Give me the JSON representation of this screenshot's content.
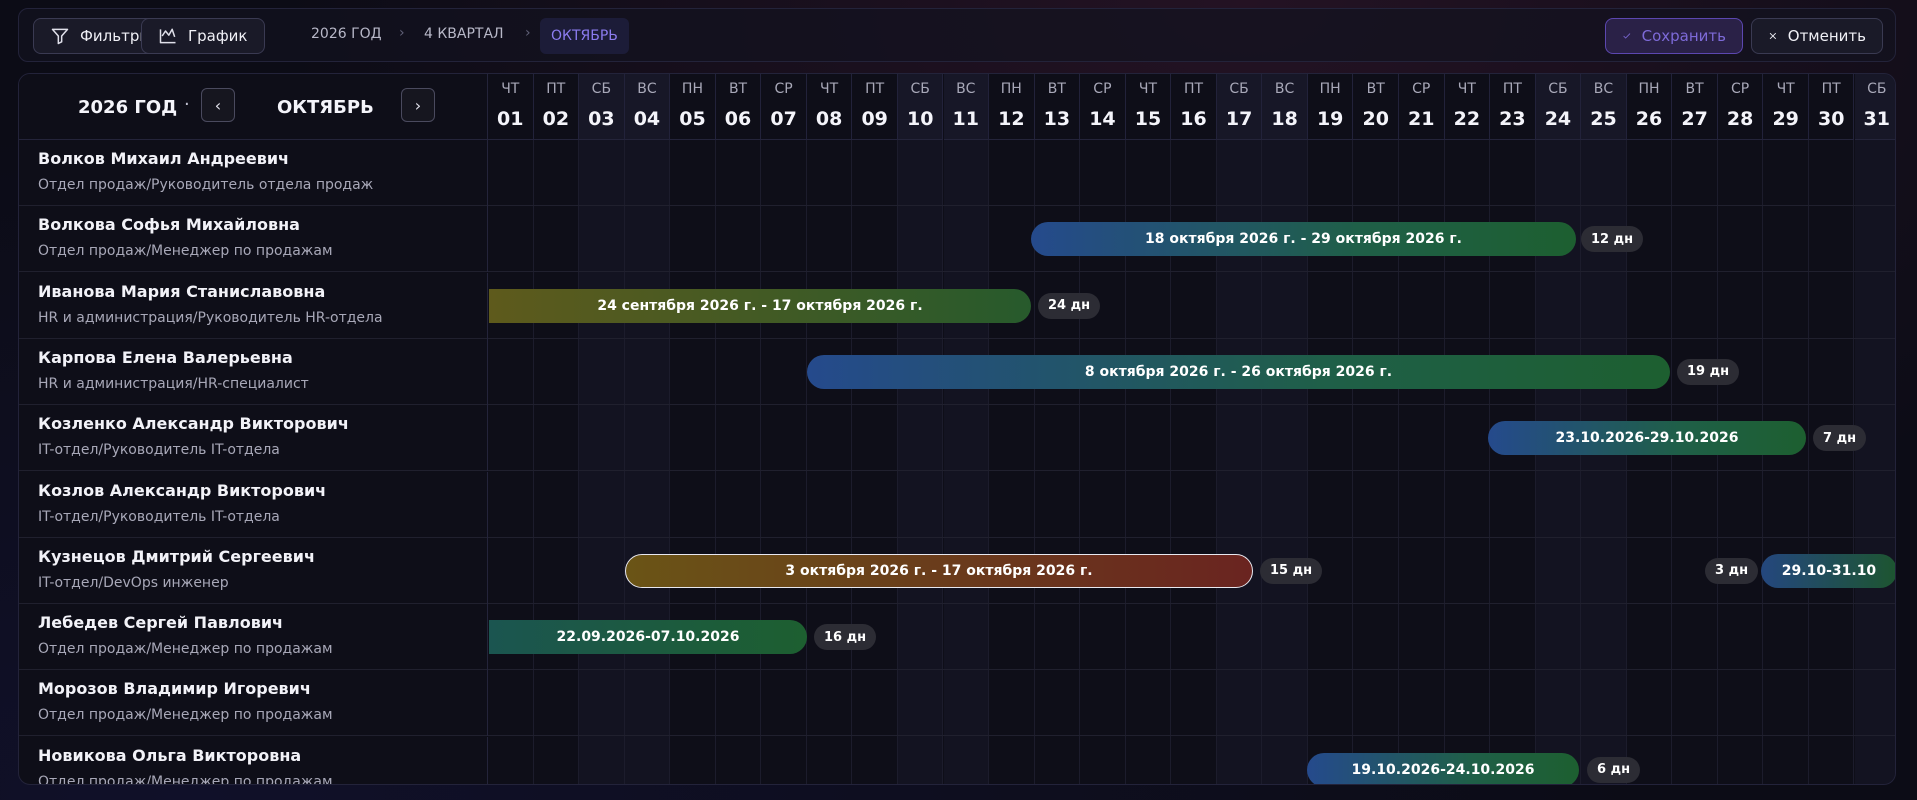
{
  "toolbar": {
    "filters_label": "Фильтры",
    "chart_label": "График",
    "breadcrumbs": [
      "2026 ГОД",
      "4 КВАРТАЛ",
      "ОКТЯБРЬ"
    ],
    "save_label": "Сохранить",
    "cancel_label": "Отменить"
  },
  "calendar": {
    "year_label": "2026 ГОД",
    "dot": "·",
    "prev": "‹",
    "next": "›",
    "month_label": "ОКТЯБРЬ",
    "days": [
      {
        "dow": "ЧТ",
        "num": "01"
      },
      {
        "dow": "ПТ",
        "num": "02"
      },
      {
        "dow": "СБ",
        "num": "03"
      },
      {
        "dow": "ВС",
        "num": "04"
      },
      {
        "dow": "ПН",
        "num": "05"
      },
      {
        "dow": "ВТ",
        "num": "06"
      },
      {
        "dow": "СР",
        "num": "07"
      },
      {
        "dow": "ЧТ",
        "num": "08"
      },
      {
        "dow": "ПТ",
        "num": "09"
      },
      {
        "dow": "СБ",
        "num": "10"
      },
      {
        "dow": "ВС",
        "num": "11"
      },
      {
        "dow": "ПН",
        "num": "12"
      },
      {
        "dow": "ВТ",
        "num": "13"
      },
      {
        "dow": "СР",
        "num": "14"
      },
      {
        "dow": "ЧТ",
        "num": "15"
      },
      {
        "dow": "ПТ",
        "num": "16"
      },
      {
        "dow": "СБ",
        "num": "17"
      },
      {
        "dow": "ВС",
        "num": "18"
      },
      {
        "dow": "ПН",
        "num": "19"
      },
      {
        "dow": "ВТ",
        "num": "20"
      },
      {
        "dow": "СР",
        "num": "21"
      },
      {
        "dow": "ЧТ",
        "num": "22"
      },
      {
        "dow": "ПТ",
        "num": "23"
      },
      {
        "dow": "СБ",
        "num": "24"
      },
      {
        "dow": "ВС",
        "num": "25"
      },
      {
        "dow": "ПН",
        "num": "26"
      },
      {
        "dow": "ВТ",
        "num": "27"
      },
      {
        "dow": "СР",
        "num": "28"
      },
      {
        "dow": "ЧТ",
        "num": "29"
      },
      {
        "dow": "ПТ",
        "num": "30"
      },
      {
        "dow": "СБ",
        "num": "31"
      }
    ]
  },
  "employees": [
    {
      "name": "Волков Михаил Андреевич",
      "dept": "Отдел продаж/Руководитель отдела продаж"
    },
    {
      "name": "Волкова Софья Михайловна",
      "dept": "Отдел продаж/Менеджер по продажам"
    },
    {
      "name": "Иванова Мария Станиславовна",
      "dept": "HR и администрация/Руководитель HR-отдела"
    },
    {
      "name": "Карпова Елена Валерьевна",
      "dept": "HR и администрация/HR-специалист"
    },
    {
      "name": "Козленко Александр Викторович",
      "dept": "IT-отдел/Руководитель IT-отдела"
    },
    {
      "name": "Козлов Александр Викторович",
      "dept": "IT-отдел/Руководитель IT-отдела"
    },
    {
      "name": "Кузнецов Дмитрий Сергеевич",
      "dept": "IT-отдел/DevOps инженер"
    },
    {
      "name": "Лебедев Сергей Павлович",
      "dept": "Отдел продаж/Менеджер по продажам"
    },
    {
      "name": "Морозов Владимир Игоревич",
      "dept": "Отдел продаж/Менеджер по продажам"
    },
    {
      "name": "Новикова Ольга Викторовна",
      "dept": "Отдел продаж/Менеджер по продажам"
    }
  ],
  "vacations": [
    {
      "label": "18 октября 2026 г. - 29 октября 2026 г.",
      "days": "12 дн"
    },
    {
      "label": "24 сентября 2026 г. - 17 октября 2026 г.",
      "days": "24 дн"
    },
    {
      "label": "8 октября 2026 г. - 26 октября 2026 г.",
      "days": "19 дн"
    },
    {
      "label": "23.10.2026-29.10.2026",
      "days": "7 дн"
    },
    {
      "label": "3 октября 2026 г. - 17 октября 2026 г.",
      "days": "15 дн"
    },
    {
      "label": "29.10-31.10",
      "days": "3 дн"
    },
    {
      "label": "22.09.2026-07.10.2026",
      "days": "16 дн"
    },
    {
      "label": "19.10.2026-24.10.2026",
      "days": "6 дн"
    }
  ]
}
